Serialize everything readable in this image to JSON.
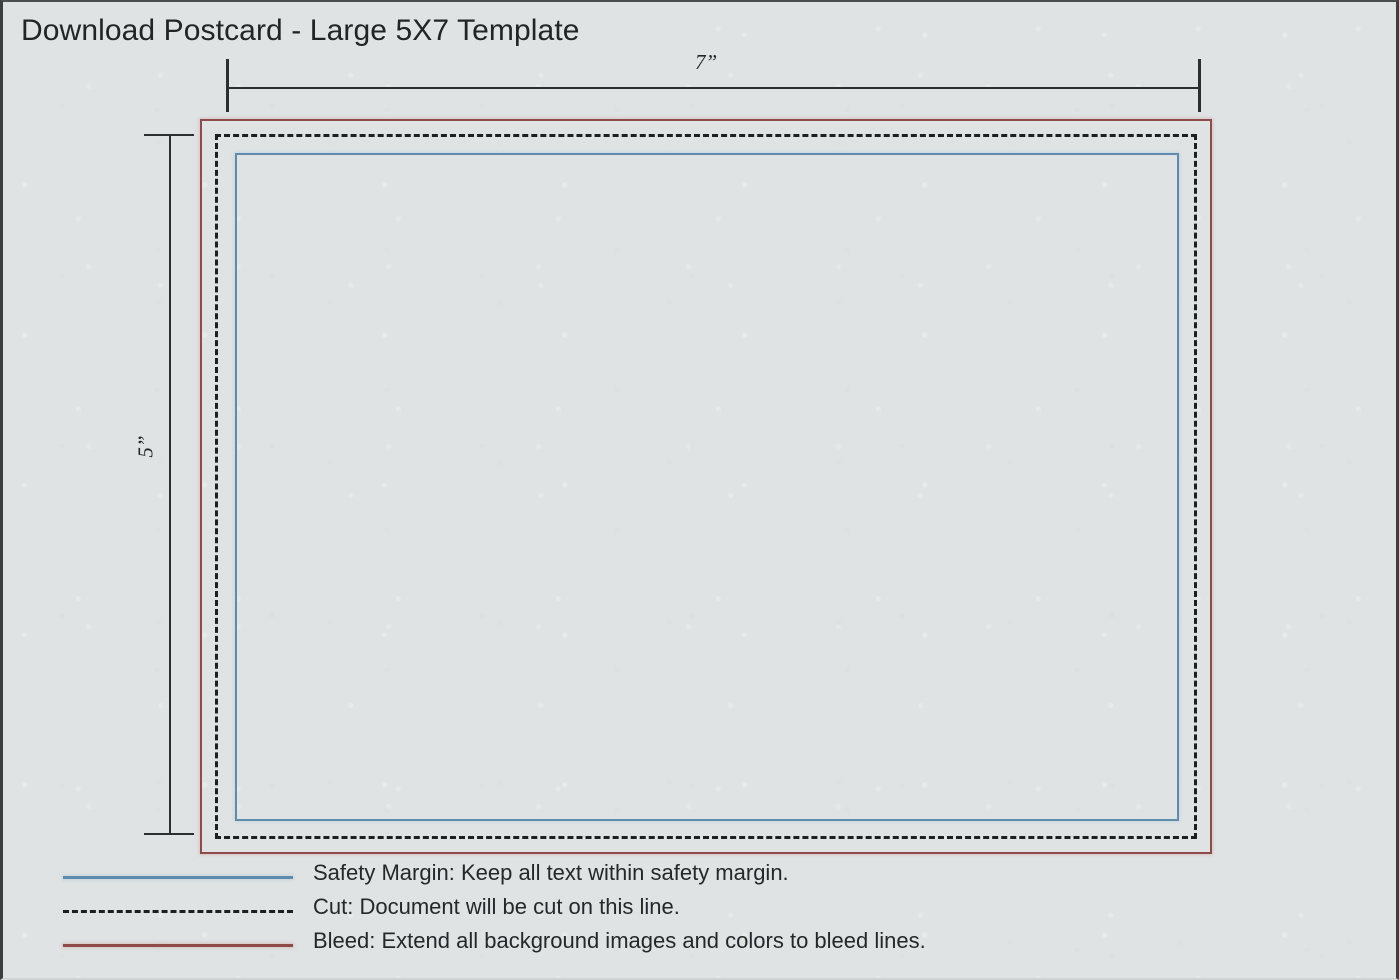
{
  "document": {
    "title": "Download Postcard - Large 5X7 Template",
    "background_color": "#dfe3e3"
  },
  "dimensions": {
    "width_label": "7”",
    "height_label": "5”"
  },
  "template_rects": {
    "bleed": {
      "name": "bleed-line",
      "color": "#8f4a4a",
      "style": "solid"
    },
    "cut": {
      "name": "cut-line",
      "color": "#1c2020",
      "style": "dashed"
    },
    "safety": {
      "name": "safety-margin-line",
      "color": "#5f8bac",
      "style": "solid"
    }
  },
  "legend": {
    "items": [
      {
        "swatch": "solid-blue",
        "color": "#5f8bac",
        "text": "Safety Margin:  Keep all text within safety margin."
      },
      {
        "swatch": "dashed-black",
        "color": "#1c2020",
        "text": "Cut:  Document will be cut on this line."
      },
      {
        "swatch": "solid-red",
        "color": "#8f4a4a",
        "text": "Bleed:  Extend all background images and colors to bleed lines."
      }
    ]
  }
}
